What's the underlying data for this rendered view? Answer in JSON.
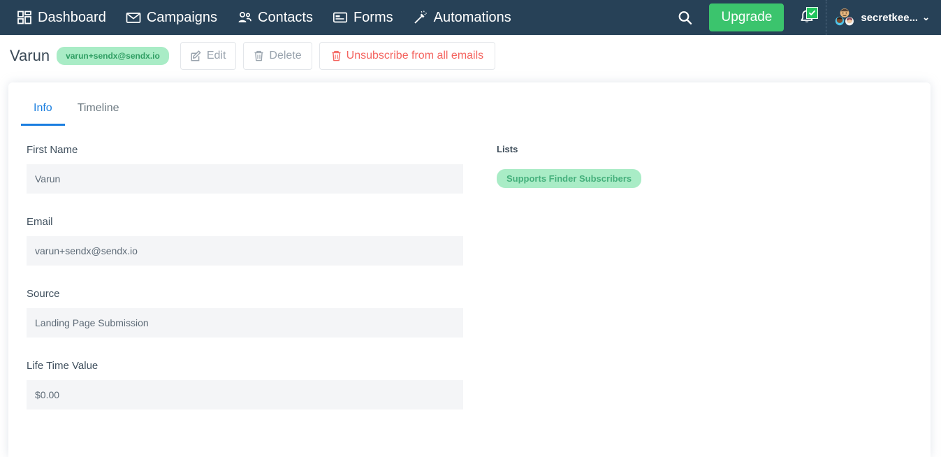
{
  "navbar": {
    "items": [
      {
        "label": "Dashboard",
        "icon": "dashboard-grid-icon"
      },
      {
        "label": "Campaigns",
        "icon": "envelope-icon"
      },
      {
        "label": "Contacts",
        "icon": "people-icon"
      },
      {
        "label": "Forms",
        "icon": "form-icon"
      },
      {
        "label": "Automations",
        "icon": "magic-wand-icon"
      }
    ],
    "search_icon": "search-icon",
    "upgrade_label": "Upgrade",
    "bell_icon": "bell-icon",
    "bell_badge_icon": "check-icon",
    "user_name": "secretkee...",
    "caret": "⌄",
    "colors": {
      "nav_background": "#274157",
      "upgrade_green": "#3bc46d",
      "badge_green": "#22c55e"
    }
  },
  "subheader": {
    "contact_name": "Varun",
    "email_badge": "varun+sendx@sendx.io",
    "edit_label": "Edit",
    "edit_icon": "pencil-square-icon",
    "delete_label": "Delete",
    "delete_icon": "trash-icon",
    "unsubscribe_label": "Unsubscribe from all emails",
    "unsubscribe_icon": "trash-icon",
    "colors": {
      "badge_bg": "#a9ecc6",
      "badge_text": "#2f9e63",
      "danger": "#f4645f",
      "muted": "#9aa4ae"
    }
  },
  "card": {
    "tabs": [
      {
        "label": "Info",
        "active": true
      },
      {
        "label": "Timeline",
        "active": false
      }
    ],
    "active_tab_color": "#1a7ee0",
    "fields": [
      {
        "label": "First Name",
        "value": "Varun"
      },
      {
        "label": "Email",
        "value": "varun+sendx@sendx.io"
      },
      {
        "label": "Source",
        "value": "Landing Page Submission"
      },
      {
        "label": "Life Time Value",
        "value": "$0.00"
      }
    ],
    "lists": {
      "label": "Lists",
      "chips": [
        "Supports Finder Subscribers"
      ],
      "chip_bg": "#a9ecc6",
      "chip_text": "#45b07c"
    }
  }
}
